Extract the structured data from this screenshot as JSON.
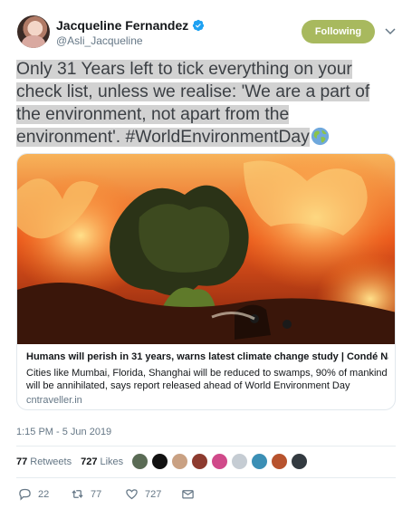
{
  "header": {
    "display_name": "Jacqueline Fernandez",
    "handle": "@Asli_Jacqueline",
    "follow_label": "Following",
    "verified_color": "#1da1f2",
    "follow_color": "#a8b95e"
  },
  "tweet": {
    "text": "Only 31 Years left to tick everything on your check list, unless we realise: 'We are a part of the environment, not apart from the environment'. #WorldEnvironmentDay",
    "emoji": "globe-icon"
  },
  "card": {
    "title": "Humans will perish in 31 years, warns latest climate change study | Condé Na...",
    "description": "Cities like Mumbai, Florida, Shanghai will be reduced to swamps, 90% of mankind will be annihilated, says report released ahead of World Environment Day",
    "domain": "cntraveller.in"
  },
  "meta": {
    "timestamp": "1:15 PM - 5 Jun 2019"
  },
  "stats": {
    "retweets_count": "77",
    "retweets_label": "Retweets",
    "likes_count": "727",
    "likes_label": "Likes"
  },
  "actions": {
    "reply_count": "22",
    "retweet_count": "77",
    "like_count": "727"
  }
}
